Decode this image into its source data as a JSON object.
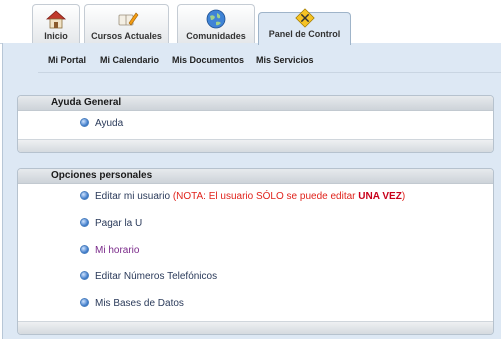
{
  "tabs": [
    {
      "label": "Inicio",
      "icon": "house-icon"
    },
    {
      "label": "Cursos Actuales",
      "icon": "book-pencil-icon"
    },
    {
      "label": "Comunidades",
      "icon": "globe-icon"
    },
    {
      "label": "Panel de Control",
      "icon": "tools-icon",
      "active": true
    }
  ],
  "subnav": [
    "Mi Portal",
    "Mi Calendario",
    "Mis Documentos",
    "Mis Servicios"
  ],
  "ayuda": {
    "title": "Ayuda General",
    "items": [
      "Ayuda"
    ]
  },
  "opciones": {
    "title": "Opciones personales",
    "edit_user": "Editar mi usuario",
    "note_open": "(NOTA: El usuario SÓLO se puede editar ",
    "note_emph": "UNA VEZ",
    "note_close": ")",
    "pay": "Pagar la U",
    "schedule": "Mi horario",
    "phones": "Editar Números Telefónicos",
    "databases": "Mis Bases de Datos"
  },
  "colors": {
    "panel_bg": "#dde8f4",
    "note_red": "#e0231c",
    "visited_link": "#7a2a8a"
  }
}
